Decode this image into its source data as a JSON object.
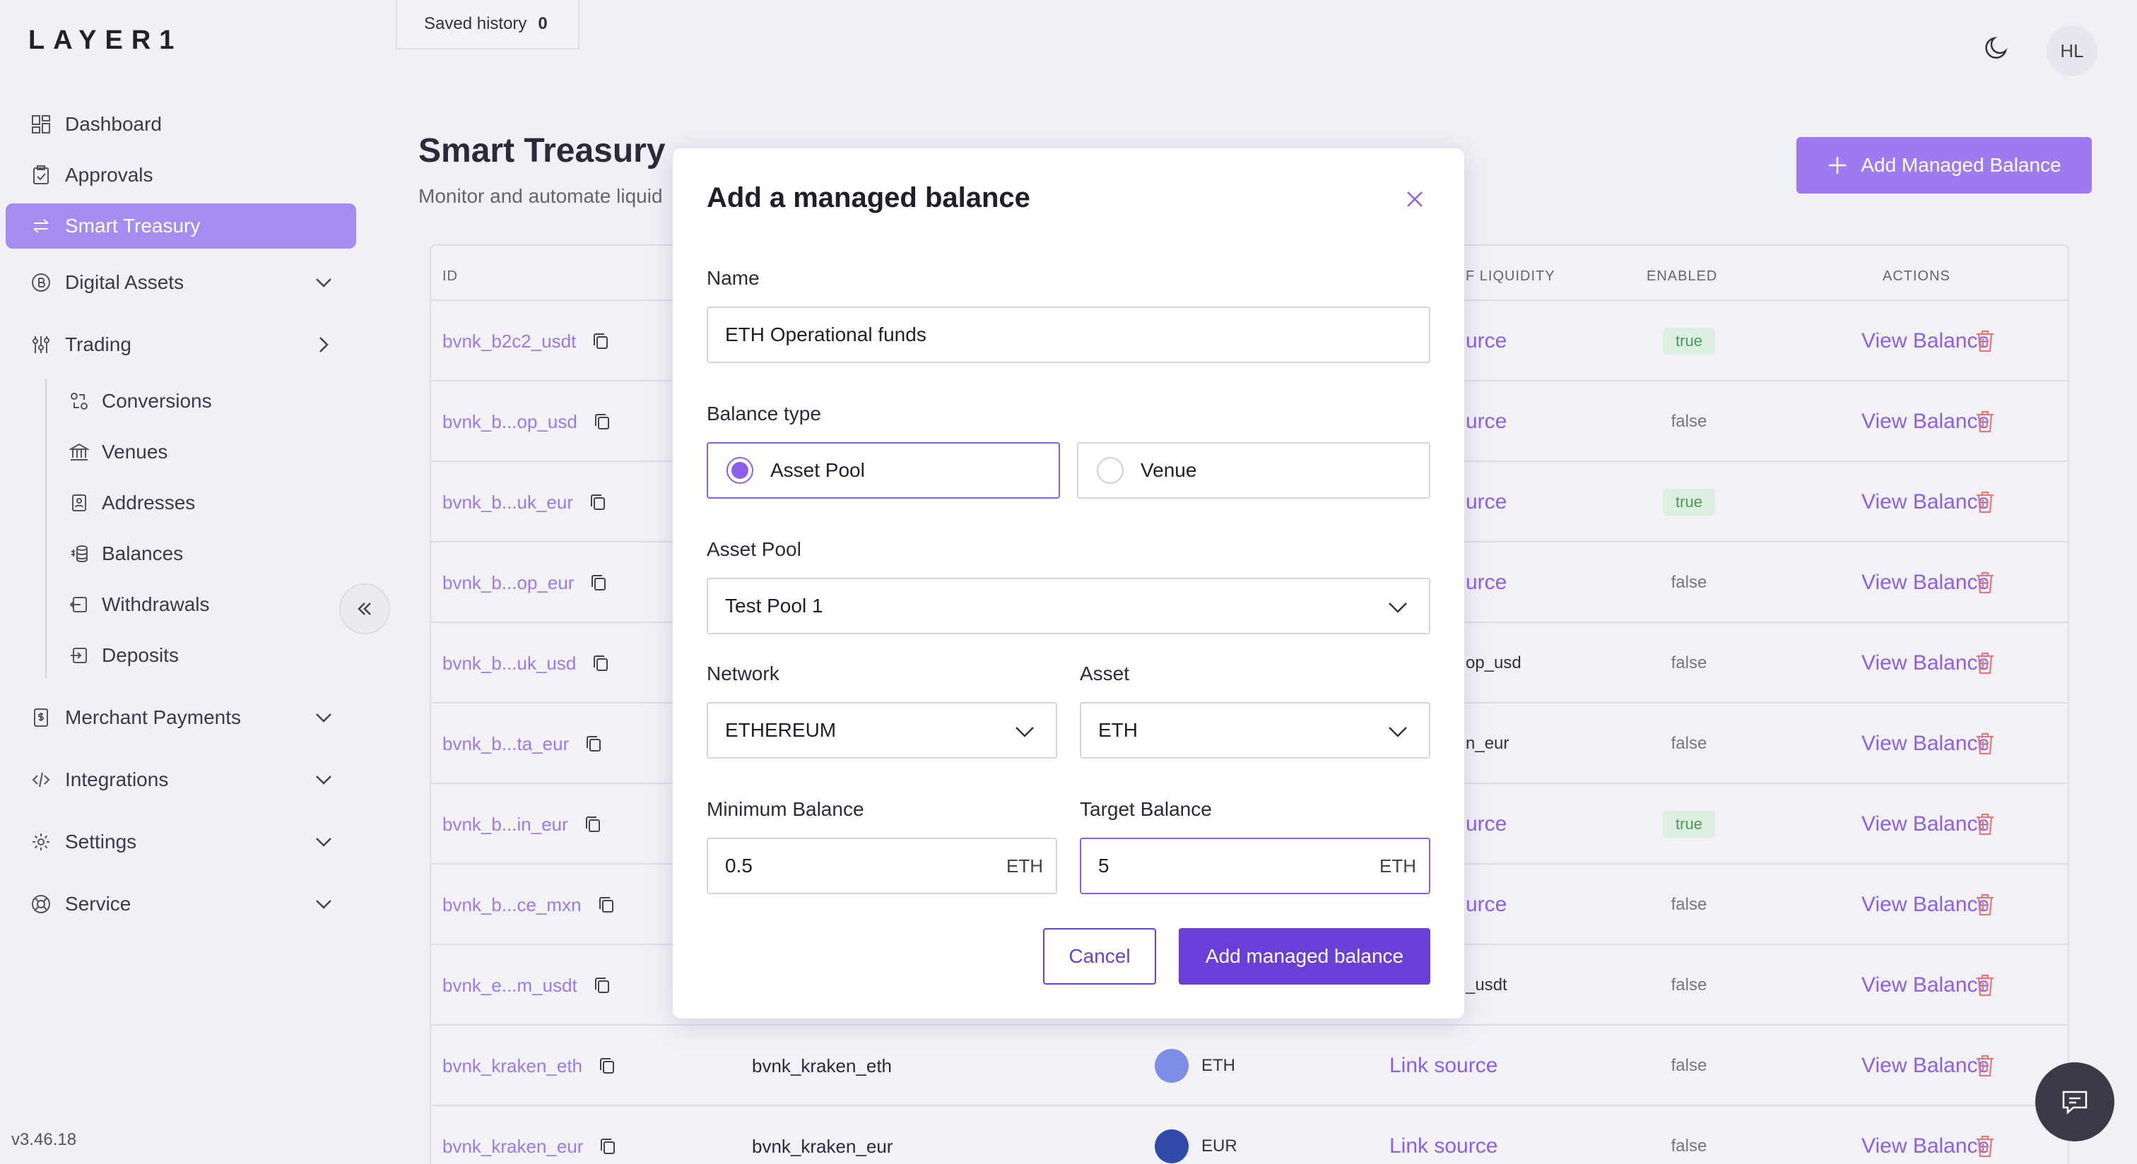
{
  "app": {
    "logo": "LAYER1",
    "version": "v3.46.18"
  },
  "topbar": {
    "saved_history_label": "Saved history",
    "saved_history_count": "0",
    "avatar_initials": "HL"
  },
  "sidebar": {
    "items": [
      {
        "label": "Dashboard"
      },
      {
        "label": "Approvals"
      },
      {
        "label": "Smart Treasury"
      },
      {
        "label": "Digital Assets"
      },
      {
        "label": "Trading"
      },
      {
        "label": "Merchant Payments"
      },
      {
        "label": "Integrations"
      },
      {
        "label": "Settings"
      },
      {
        "label": "Service"
      }
    ],
    "trading_sub": [
      {
        "label": "Conversions"
      },
      {
        "label": "Venues"
      },
      {
        "label": "Addresses"
      },
      {
        "label": "Balances"
      },
      {
        "label": "Withdrawals"
      },
      {
        "label": "Deposits"
      }
    ]
  },
  "page": {
    "title": "Smart Treasury",
    "subtitle": "Monitor and automate liquid",
    "add_button": "Add Managed Balance"
  },
  "table": {
    "headers": {
      "id": "ID",
      "source": "F LIQUIDITY",
      "enabled": "ENABLED",
      "actions": "ACTIONS"
    },
    "rows": [
      {
        "id": "bvnk_b2c2_usdt",
        "source": "urce",
        "enabled": "true",
        "action": "View Balance"
      },
      {
        "id": "bvnk_b...op_usd",
        "source": "urce",
        "enabled": "false",
        "action": "View Balance"
      },
      {
        "id": "bvnk_b...uk_eur",
        "source": "urce",
        "enabled": "true",
        "action": "View Balance"
      },
      {
        "id": "bvnk_b...op_eur",
        "source": "urce",
        "enabled": "false",
        "action": "View Balance"
      },
      {
        "id": "bvnk_b...uk_usd",
        "source": "op_usd",
        "enabled": "false",
        "action": "View Balance"
      },
      {
        "id": "bvnk_b...ta_eur",
        "source": "n_eur",
        "enabled": "false",
        "action": "View Balance"
      },
      {
        "id": "bvnk_b...in_eur",
        "source": "urce",
        "enabled": "true",
        "action": "View Balance"
      },
      {
        "id": "bvnk_b...ce_mxn",
        "source": "urce",
        "enabled": "false",
        "action": "View Balance"
      },
      {
        "id": "bvnk_e...m_usdt",
        "source": "_usdt",
        "enabled": "false",
        "action": "View Balance"
      },
      {
        "id": "bvnk_kraken_eth",
        "name": "bvnk_kraken_eth",
        "asset": "ETH",
        "source": "Link source",
        "enabled": "false",
        "action": "View Balance"
      },
      {
        "id": "bvnk_kraken_eur",
        "name": "bvnk_kraken_eur",
        "asset": "EUR",
        "source": "Link source",
        "enabled": "false",
        "action": "View Balance"
      }
    ]
  },
  "modal": {
    "title": "Add a managed balance",
    "name_label": "Name",
    "name_value": "ETH Operational funds",
    "balance_type_label": "Balance type",
    "balance_type_options": [
      "Asset Pool",
      "Venue"
    ],
    "asset_pool_label": "Asset Pool",
    "asset_pool_value": "Test Pool 1",
    "network_label": "Network",
    "network_value": "ETHEREUM",
    "asset_label": "Asset",
    "asset_value": "ETH",
    "min_label": "Minimum Balance",
    "min_value": "0.5",
    "min_unit": "ETH",
    "target_label": "Target Balance",
    "target_value": "5",
    "target_unit": "ETH",
    "cancel_label": "Cancel",
    "submit_label": "Add managed balance"
  },
  "colors": {
    "accent": "#6a3fd8",
    "accent_light": "#9e7af0",
    "danger": "#e07a7a"
  }
}
